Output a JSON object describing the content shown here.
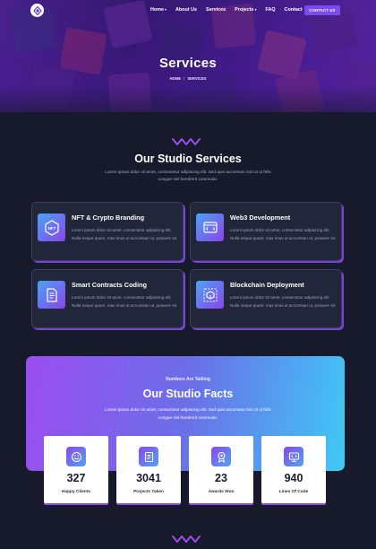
{
  "nav": {
    "items": [
      {
        "label": "Home",
        "has_dropdown": true
      },
      {
        "label": "About Us",
        "has_dropdown": false
      },
      {
        "label": "Services",
        "has_dropdown": false
      },
      {
        "label": "Projects",
        "has_dropdown": true
      },
      {
        "label": "FAQ",
        "has_dropdown": false
      },
      {
        "label": "Contact",
        "has_dropdown": false
      }
    ],
    "cta_label": "CONTACT US"
  },
  "hero": {
    "title": "Services",
    "breadcrumb": {
      "home": "HOME",
      "separator": "/",
      "current": "SERVICES"
    }
  },
  "services": {
    "title": "Our Studio Services",
    "description": "Lorem ipsum dolor sit amet, consectetur adipiscing elit. Sed quis accumsan nisi Ut ut felis congue nisl hendrerit commodo.",
    "cards": [
      {
        "title": "NFT & Crypto Branding",
        "text": "Lorem ipsum dolor sit amet, consectetur adipiscing elit. Nulla neque quam, max imus ut accumsan ut, posuere sit.",
        "icon": "nft-badge-icon"
      },
      {
        "title": "Web3 Development",
        "text": "Lorem ipsum dolor sit amet, consectetur adipiscing elit. Nulla neque quam, max imus ut accumsan ut, posuere sit.",
        "icon": "web3-code-icon"
      },
      {
        "title": "Smart Contracts Coding",
        "text": "Lorem ipsum dolor sit amet, consectetur adipiscing elit. Nulla neque quam, max imus ut accumsan ut, posuere sit.",
        "icon": "contract-document-icon"
      },
      {
        "title": "Blockchain Deployment",
        "text": "Lorem ipsum dolor sit amet, consectetur adipiscing elit. Nulla neque quam, max imus ut accumsan ut, posuere sit.",
        "icon": "blockchain-cube-icon"
      }
    ]
  },
  "facts": {
    "kicker": "Numbers Are Talking",
    "title": "Our Studio Facts",
    "description": "Lorem ipsum dolor sit amet, consectetur adipiscing elit. Sed quis accumsan nisi Ut ut felis congue nisl hendrerit commodo.",
    "stats": [
      {
        "value": "327",
        "label": "Happy Clients",
        "icon": "happy-client-icon"
      },
      {
        "value": "3041",
        "label": "Projects Taken",
        "icon": "project-icon"
      },
      {
        "value": "23",
        "label": "Awards Won",
        "icon": "award-icon"
      },
      {
        "value": "940",
        "label": "Lines Of Code",
        "icon": "monitor-code-icon"
      }
    ]
  },
  "colors": {
    "background": "#161a2b",
    "card": "#21263a",
    "accent_purple": "#8a44ea",
    "accent_cyan": "#3fc9f6",
    "cta": "#7a4cf0"
  }
}
